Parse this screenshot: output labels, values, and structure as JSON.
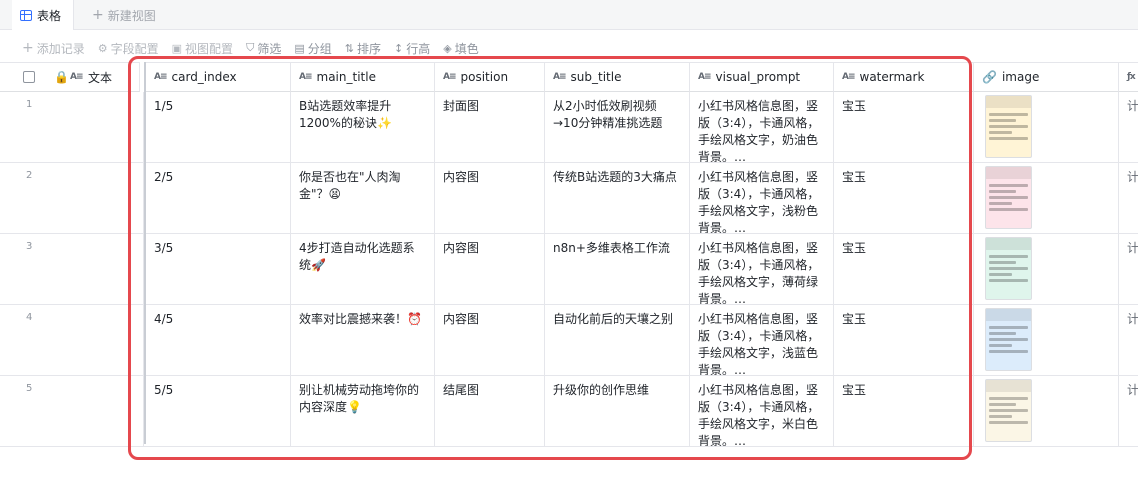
{
  "tabs": {
    "active_label": "表格",
    "new_view_label": "新建视图"
  },
  "toolbar": {
    "add_record": "添加记录",
    "field_config": "字段配置",
    "view_config": "视图配置",
    "filter": "筛选",
    "group": "分组",
    "sort": "排序",
    "row_height": "行高",
    "fill_color": "填色"
  },
  "columns": {
    "text": "文本",
    "card_index": "card_index",
    "main_title": "main_title",
    "position": "position",
    "sub_title": "sub_title",
    "visual_prompt": "visual_prompt",
    "watermark": "watermark",
    "image": "image"
  },
  "rows": [
    {
      "num": "1",
      "card_index": "1/5",
      "main_title": "B站选题效率提升1200%的秘诀✨",
      "position": "封面图",
      "sub_title": "从2小时低效刷视频→10分钟精准挑选题",
      "visual_prompt": "小红书风格信息图，竖版（3:4），卡通风格，手绘风格文字，奶油色背景。…",
      "watermark": "宝玉",
      "extra": "计"
    },
    {
      "num": "2",
      "card_index": "2/5",
      "main_title": "你是否也在\"人肉淘金\"？😫",
      "position": "内容图",
      "sub_title": "传统B站选题的3大痛点",
      "visual_prompt": "小红书风格信息图，竖版（3:4），卡通风格，手绘风格文字，浅粉色背景。…",
      "watermark": "宝玉",
      "extra": "计"
    },
    {
      "num": "3",
      "card_index": "3/5",
      "main_title": "4步打造自动化选题系统🚀",
      "position": "内容图",
      "sub_title": "n8n+多维表格工作流",
      "visual_prompt": "小红书风格信息图，竖版（3:4），卡通风格，手绘风格文字，薄荷绿背景。…",
      "watermark": "宝玉",
      "extra": "计"
    },
    {
      "num": "4",
      "card_index": "4/5",
      "main_title": "效率对比震撼来袭！⏰",
      "position": "内容图",
      "sub_title": "自动化前后的天壤之别",
      "visual_prompt": "小红书风格信息图，竖版（3:4），卡通风格，手绘风格文字，浅蓝色背景。…",
      "watermark": "宝玉",
      "extra": "计"
    },
    {
      "num": "5",
      "card_index": "5/5",
      "main_title": "别让机械劳动拖垮你的内容深度💡",
      "position": "结尾图",
      "sub_title": "升级你的创作思维",
      "visual_prompt": "小红书风格信息图，竖版（3:4），卡通风格，手绘风格文字，米白色背景。…",
      "watermark": "宝玉",
      "extra": "计"
    }
  ],
  "thumb_colors": [
    "#fff4d6",
    "#fde4ea",
    "#dff5ec",
    "#dcecfb",
    "#fbf6e6"
  ],
  "highlight_color": "#e5484d",
  "accent": "#3370ff"
}
